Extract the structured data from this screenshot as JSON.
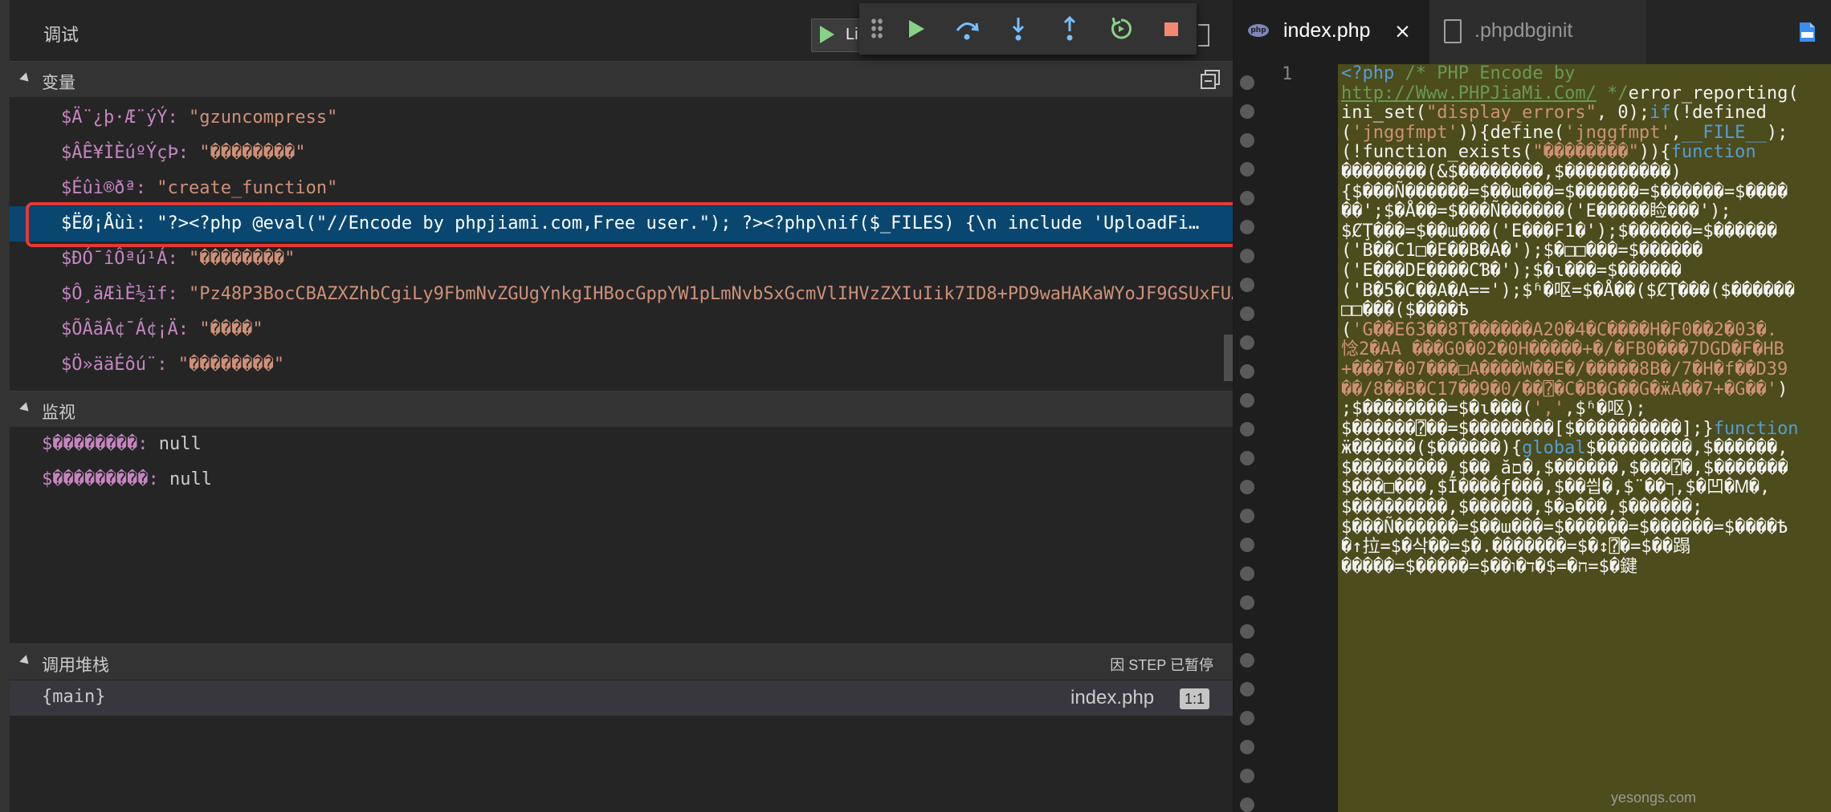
{
  "debug_panel": {
    "title": "调试",
    "run_config_label": "Li"
  },
  "sections": {
    "variables": "变量",
    "watch": "监视",
    "call_stack": "调用堆栈"
  },
  "variables": [
    {
      "name": "$Ä¨¿þ·Æ¨ýÝ",
      "value": "\"gzuncompress\""
    },
    {
      "name": "$ÂÊ¥ÌÈúºÝçÞ",
      "value": "\"��������\""
    },
    {
      "name": "$Éûì®ðª",
      "value": "\"create_function\""
    },
    {
      "name": "$ËØ¡Åùì",
      "value": "\"?><?php @eval(\"//Encode by  phpjiami.com,Free user.\"); ?><?php\\nif($_FILES) {\\n    include 'UploadFi…"
    },
    {
      "name": "$ÐÓ¯îÔªú¹Á",
      "value": "\"��������\""
    },
    {
      "name": "$Ô¸äÆìÈ½ïf",
      "value": "\"Pz48P3BocCBAZXZhbCgiLy9FbmNvZGUgYnkgIHBocGppYW1pLmNvbSxGcmVlIHVzZXIuIik7ID8+PD9waHAKaWYoJF9GSUxFU…"
    },
    {
      "name": "$ÕÂãÂ¢¯Á¢¡Ä",
      "value": "\"����\""
    },
    {
      "name": "$Ö»ääÉôú¨",
      "value": "\"��������\""
    }
  ],
  "watch": [
    {
      "name": "$��������",
      "value": "null"
    },
    {
      "name": "$���������",
      "value": "null"
    }
  ],
  "call_stack": {
    "state": "因 STEP 已暂停",
    "frame": "{main}",
    "file": "index.php",
    "position": "1:1"
  },
  "editor": {
    "tabs": [
      {
        "label": "index.php",
        "close": "×"
      },
      {
        "label": ".phpdbginit"
      }
    ],
    "line_number": "1",
    "watermark": "yesongs.com"
  },
  "colors": {
    "accent_selection": "#094771",
    "highlight_box": "#e53935",
    "code_bg": "#4c4c1c"
  }
}
